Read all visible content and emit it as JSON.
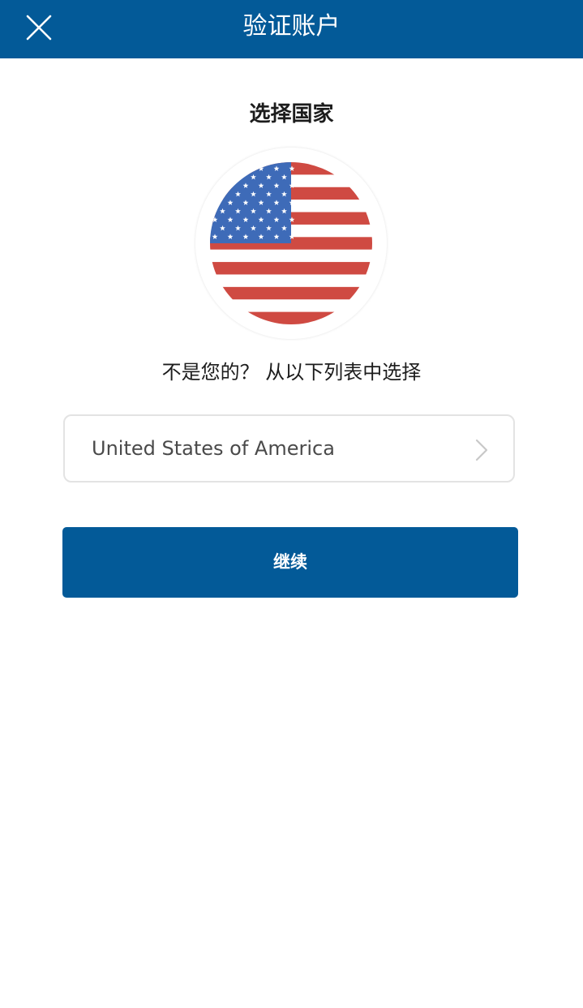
{
  "header": {
    "title": "验证账户",
    "close_icon": "close-icon"
  },
  "main": {
    "section_title": "选择国家",
    "flag_icon": "us-flag-icon",
    "prompt": "不是您的？ 从以下列表中选择",
    "country_select": {
      "value": "United States of America",
      "chevron_icon": "chevron-right-icon"
    },
    "continue_label": "继续"
  },
  "colors": {
    "primary": "#035a98",
    "flag_red": "#cf4a42",
    "flag_blue": "#3e6bb8"
  }
}
